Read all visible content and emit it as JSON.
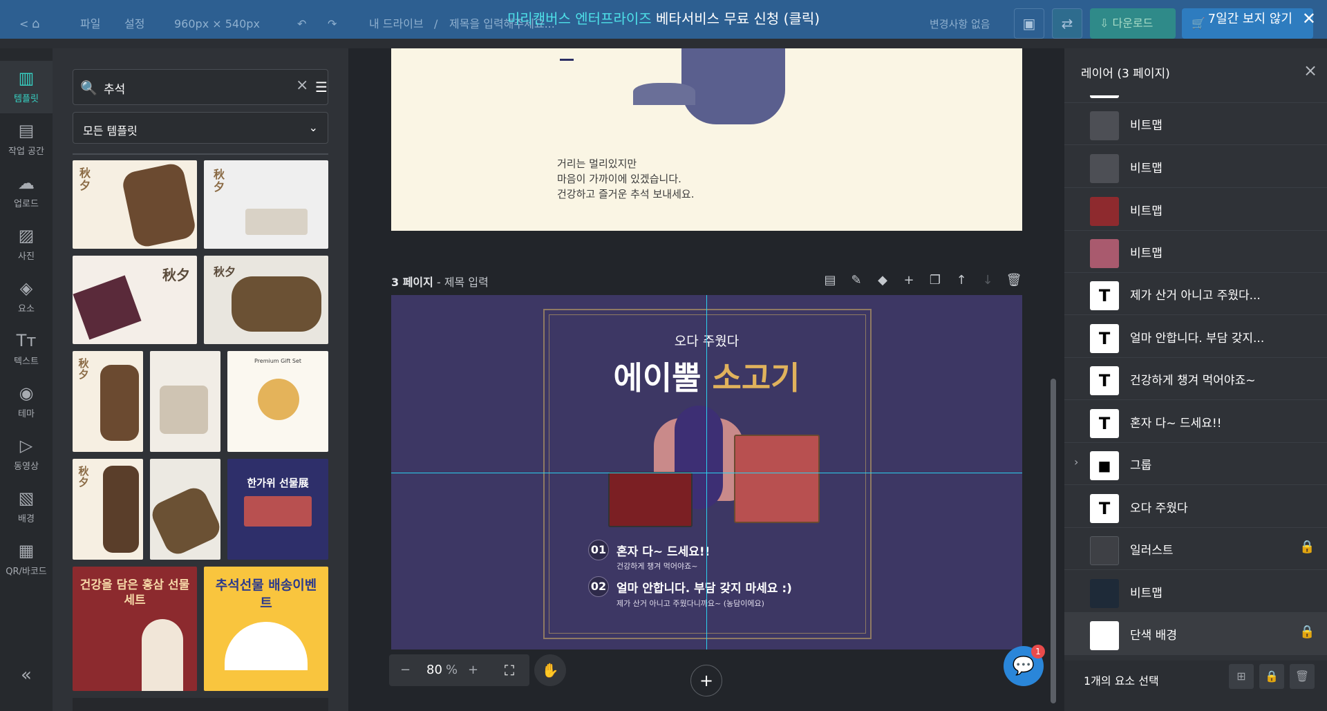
{
  "topbar": {
    "back_label": "<",
    "home_icon": "home-icon",
    "menu_file": "파일",
    "menu_settings": "설정",
    "canvas_size": "960px × 540px",
    "drive_label": "내 드라이브",
    "separator": "/",
    "doc_title": "제목을 입력해주세요...",
    "plan_text": "변경사항 없음",
    "download_label": "다운로드"
  },
  "banner": {
    "highlight": "미리캔버스 엔터프라이즈",
    "text": " 베타서비스 무료 신청 (클릭)",
    "dismiss": "7일간 보지 않기",
    "close": "✕"
  },
  "leftnav": {
    "items": [
      {
        "label": "템플릿",
        "icon": "template-icon"
      },
      {
        "label": "작업 공간",
        "icon": "workspace-icon"
      },
      {
        "label": "업로드",
        "icon": "upload-icon"
      },
      {
        "label": "사진",
        "icon": "photo-icon"
      },
      {
        "label": "요소",
        "icon": "elements-icon"
      },
      {
        "label": "텍스트",
        "icon": "text-icon"
      },
      {
        "label": "테마",
        "icon": "palette-icon"
      },
      {
        "label": "동영상",
        "icon": "video-icon"
      },
      {
        "label": "배경",
        "icon": "background-icon"
      },
      {
        "label": "QR/바코드",
        "icon": "qr-icon"
      }
    ],
    "collapse": "«"
  },
  "template_panel": {
    "search_value": "추석",
    "filter_select": "모든 템플릿",
    "thumbnails": [
      {
        "text": "秋夕"
      },
      {
        "text": "秋夕"
      },
      {
        "text": "秋夕"
      },
      {
        "text": "秋夕"
      },
      {
        "text": "秋夕"
      },
      {
        "text": ""
      },
      {
        "text": "Premium Gift Set"
      },
      {
        "text": "秋夕"
      },
      {
        "text": ""
      },
      {
        "text": "한가위 선물展"
      },
      {
        "text": "건강을 담은 홍삼 선물세트"
      },
      {
        "text": "추석선물 배송이벤트"
      }
    ]
  },
  "canvas": {
    "page2_lines": [
      "거리는 멀리있지만",
      "마음이 가까이에 있겠습니다.",
      "건강하고 즐거운 추석 보내세요."
    ],
    "page3_header_num": "3 페이지",
    "page3_header_sep": " - ",
    "page3_header_title": "제목 입력",
    "page3": {
      "small_title": "오다 주웠다",
      "big_title_white": "에이뿔 ",
      "big_title_gold": "소고기",
      "item1_num": "01",
      "item1_title": "혼자 다~ 드세요!!",
      "item1_sub": "건강하게 챙겨 먹어야죠~",
      "item2_num": "02",
      "item2_title": "얼마 안합니다. 부담 갖지 마세요 :)",
      "item2_sub": "제가 산거 아니고 주웠다니까요~ (농담이에요)"
    },
    "zoom_value": "80",
    "zoom_unit": "%",
    "chat_badge": "1"
  },
  "layers_panel": {
    "title": "레이어 (3 페이지)",
    "layers": [
      {
        "name": "",
        "type": "bitmap"
      },
      {
        "name": "비트맵",
        "type": "bitmap"
      },
      {
        "name": "비트맵",
        "type": "bitmap"
      },
      {
        "name": "비트맵",
        "type": "bitmap"
      },
      {
        "name": "비트맵",
        "type": "bitmap"
      },
      {
        "name": "제가 산거 아니고 주웠다...",
        "type": "text"
      },
      {
        "name": "얼마 안합니다. 부담 갖지...",
        "type": "text"
      },
      {
        "name": "건강하게 챙겨 먹어야죠~",
        "type": "text"
      },
      {
        "name": "혼자 다~ 드세요!!",
        "type": "text"
      },
      {
        "name": "그룹",
        "type": "group"
      },
      {
        "name": "오다 주웠다",
        "type": "text"
      },
      {
        "name": "일러스트",
        "type": "illust",
        "locked": true
      },
      {
        "name": "비트맵",
        "type": "bitmap"
      },
      {
        "name": "단색 배경",
        "type": "solid",
        "locked": true
      }
    ],
    "footer_text": "1개의 요소 선택"
  },
  "colors": {
    "accent": "#37d2c4",
    "banner_highlight": "#4ee0e8",
    "topbar": "#2d5f91",
    "page3_bg": "#3d3764",
    "gold": "#e0b25c"
  }
}
